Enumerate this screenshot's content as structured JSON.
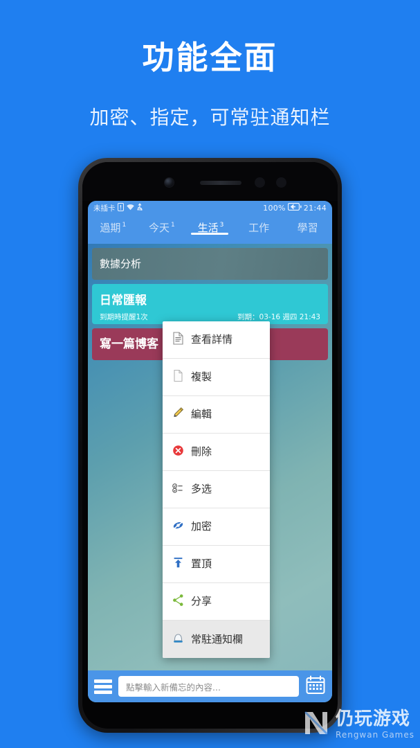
{
  "promo": {
    "headline": "功能全面",
    "subtitle": "加密、指定，可常驻通知栏",
    "bg_color": "#1f7ff0"
  },
  "status_bar": {
    "carrier": "未插卡",
    "icons": [
      "sim-alert-icon",
      "wifi-icon",
      "usb-icon"
    ],
    "battery_percent": "100%",
    "battery_icon": "battery-charging-icon",
    "time": "21:44"
  },
  "tabs": [
    {
      "label": "過期",
      "badge": "1",
      "active": false
    },
    {
      "label": "今天",
      "badge": "1",
      "active": false
    },
    {
      "label": "生活",
      "badge": "3",
      "active": true
    },
    {
      "label": "工作",
      "badge": "",
      "active": false
    },
    {
      "label": "學習",
      "badge": "",
      "active": false
    }
  ],
  "cards": [
    {
      "title": "數據分析",
      "reminder": "",
      "due": "",
      "color": "#5a7a80"
    },
    {
      "title": "日常匯報",
      "reminder": "到期時提醒1次",
      "due": "到期：03-16 週四 21:43",
      "color": "#2fc8d4"
    },
    {
      "title": "寫一篇博客",
      "reminder": "",
      "due": "",
      "color": "#9a3a59"
    }
  ],
  "context_menu": [
    {
      "label": "查看詳情",
      "icon": "document-lines-icon",
      "pressed": false
    },
    {
      "label": "複製",
      "icon": "copy-page-icon",
      "pressed": false
    },
    {
      "label": "編輯",
      "icon": "pencil-icon",
      "pressed": false
    },
    {
      "label": "刪除",
      "icon": "delete-circle-icon",
      "pressed": false
    },
    {
      "label": "多选",
      "icon": "multi-select-icon",
      "pressed": false
    },
    {
      "label": "加密",
      "icon": "encrypt-eye-slash-icon",
      "pressed": false
    },
    {
      "label": "置頂",
      "icon": "pin-top-icon",
      "pressed": false
    },
    {
      "label": "分享",
      "icon": "share-icon",
      "pressed": false
    },
    {
      "label": "常駐通知欄",
      "icon": "bell-notification-icon",
      "pressed": true
    }
  ],
  "bottom_bar": {
    "menu_icon": "hamburger-icon",
    "input_placeholder": "點擊輸入新備忘的內容...",
    "calendar_icon": "calendar-icon"
  },
  "watermark": {
    "logo": "rengwan-logo-icon",
    "name_cn": "仍玩游戏",
    "name_en": "Rengwan Games"
  }
}
